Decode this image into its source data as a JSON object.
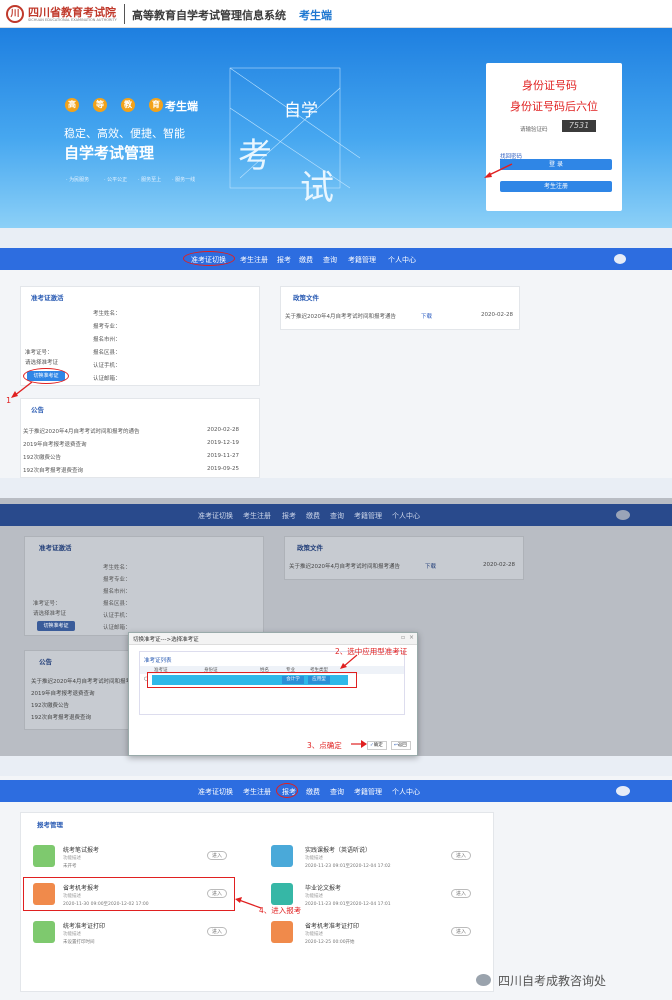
{
  "header": {
    "org_name": "四川省教育考试院",
    "org_name_en": "SICHUAN EDUCATIONAL EXAMINATION AUTHORITY",
    "system_title": "高等教育自学考试管理信息系统",
    "portal": "考生端"
  },
  "banner": {
    "badge_chars": [
      "高",
      "等",
      "教",
      "育"
    ],
    "badge_suffix": "考生端",
    "slogan": "稳定、高效、便捷、智能",
    "main_title": "自学考试管理",
    "deco_chars": [
      "自学",
      "考",
      "试"
    ],
    "tags": [
      "· 为民服务",
      "· 公平公正",
      "· 服务至上",
      "· 服务一线"
    ]
  },
  "login": {
    "annot_id": "身份证号码",
    "annot_pw": "身份证号码后六位",
    "captcha_label": "请输验证码",
    "captcha_value": "7531",
    "forgot": "找回密码",
    "login_btn": "登 录",
    "register_btn": "考生注册"
  },
  "nav": {
    "items": [
      "准考证切换",
      "考生注册",
      "报考",
      "缴费",
      "查询",
      "考籍管理",
      "个人中心"
    ]
  },
  "activation": {
    "title": "准考证激活",
    "fields": [
      "考生姓名：",
      "报考专业：",
      "报名市州：",
      "报名区县：",
      "认证手机：",
      "认证邮箱："
    ],
    "zkz_label": "准考证号：",
    "hint": "请选择准考证",
    "switch_btn": "切换准考证",
    "annot_step1": "1"
  },
  "notices": {
    "title": "公告",
    "items": [
      {
        "text": "关于推迟2020年4月自考考试时间和报考的通告",
        "date": "2020-02-28"
      },
      {
        "text": "2019年自考报考退费查询",
        "date": "2019-12-19"
      },
      {
        "text": "192次缴费公告",
        "date": "2019-11-27"
      },
      {
        "text": "192次自考报考退费查询",
        "date": "2019-09-25"
      }
    ]
  },
  "docs": {
    "title": "政策文件",
    "item": "关于推迟2020年4月自考考试时间和报考通告",
    "download": "下载",
    "date": "2020-02-28"
  },
  "dialog": {
    "title": "切换准考证--->选择准考证",
    "list_title": "准考证列表",
    "cols": [
      "准考证",
      "身份证",
      "姓名",
      "专业",
      "考生类型"
    ],
    "row_major": "会计学",
    "row_type": "应用型",
    "confirm": "确定",
    "back": "返回",
    "annot_step2": "2、选中应用型准考证",
    "annot_step3": "3、点确定"
  },
  "registration": {
    "title": "报考管理",
    "desc_label": "功能描述",
    "enter": "进入",
    "annot_step4": "4、进入报考",
    "items": [
      {
        "name": "统考笔试报考",
        "status": "未开考"
      },
      {
        "name": "实践课报考（英语听说）",
        "status": "2020-11-23 09:01至2020-12-04 17:02"
      },
      {
        "name": "省考机考报考",
        "status": "2020-11-30 09:00至2020-12-02 17:00"
      },
      {
        "name": "毕业论文报考",
        "status": "2020-11-23 09:01至2020-12-04 17:01"
      },
      {
        "name": "统考准考证打印",
        "status": "未设置打印时间"
      },
      {
        "name": "省考机考准考证打印",
        "status": "2020-12-25 00:00开始"
      }
    ]
  },
  "watermark": "四川自考成教咨询处",
  "colors": {
    "nav": "#2d6de0",
    "annotation": "#e02020",
    "accent": "#2f86e6"
  }
}
